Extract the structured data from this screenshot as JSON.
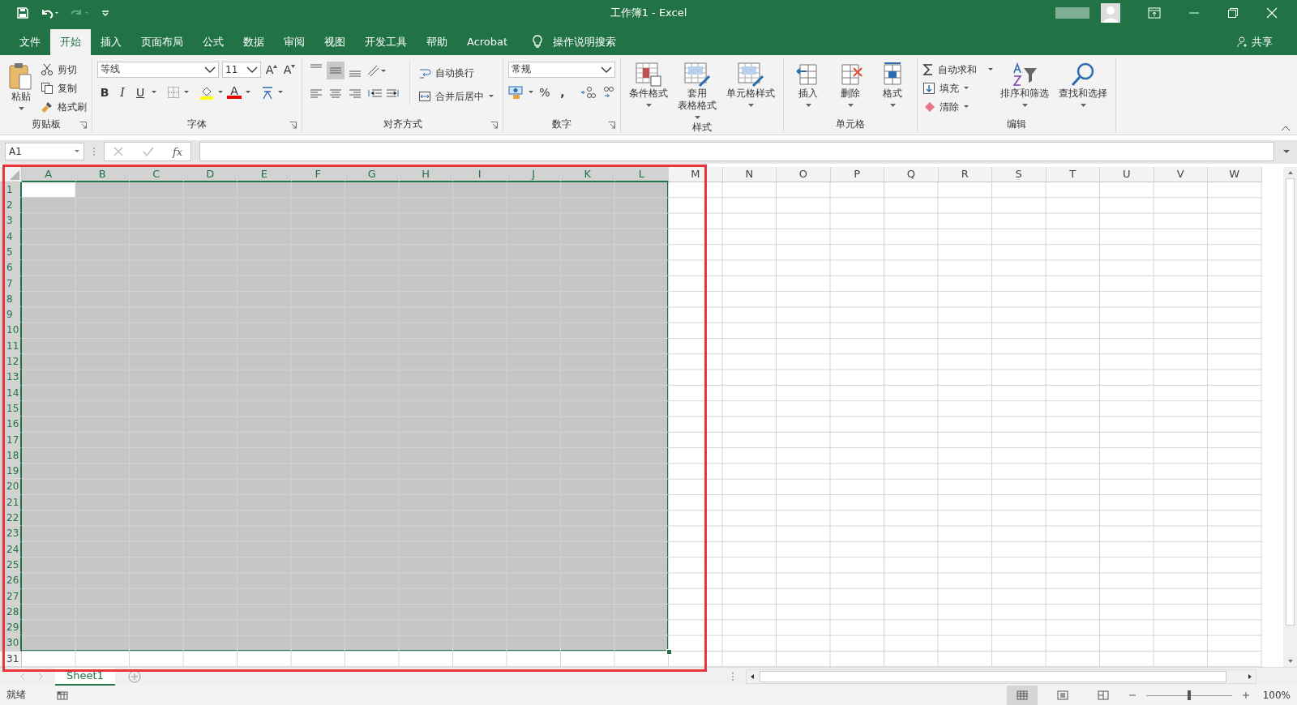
{
  "title_bar": {
    "title": "工作簿1  -  Excel",
    "share": "共享"
  },
  "tabs": [
    {
      "label": "文件",
      "selected": false
    },
    {
      "label": "开始",
      "selected": true
    },
    {
      "label": "插入",
      "selected": false
    },
    {
      "label": "页面布局",
      "selected": false
    },
    {
      "label": "公式",
      "selected": false
    },
    {
      "label": "数据",
      "selected": false
    },
    {
      "label": "审阅",
      "selected": false
    },
    {
      "label": "视图",
      "selected": false
    },
    {
      "label": "开发工具",
      "selected": false
    },
    {
      "label": "帮助",
      "selected": false
    },
    {
      "label": "Acrobat",
      "selected": false
    }
  ],
  "tell_me": "操作说明搜索",
  "ribbon": {
    "clipboard": {
      "label": "剪贴板",
      "paste": "粘贴",
      "cut": "剪切",
      "copy": "复制",
      "format_painter": "格式刷"
    },
    "font": {
      "label": "字体",
      "font_name": "等线",
      "font_size": "11",
      "grow": "A",
      "shrink": "A",
      "styles": [
        "B",
        "I",
        "U"
      ],
      "font_color": "A"
    },
    "alignment": {
      "label": "对齐方式",
      "wrap_text": "自动换行",
      "merge_center": "合并后居中"
    },
    "number": {
      "label": "数字",
      "format": "常规",
      "buttons": [
        "%",
        ","
      ]
    },
    "styles": {
      "label": "样式",
      "items": [
        {
          "lines": [
            "条件格式"
          ]
        },
        {
          "lines": [
            "套用",
            "表格格式"
          ]
        },
        {
          "lines": [
            "单元格样式"
          ]
        }
      ]
    },
    "cells": {
      "label": "单元格",
      "items": [
        "插入",
        "删除",
        "格式"
      ]
    },
    "editing": {
      "label": "编辑",
      "autosum": "自动求和",
      "fill": "填充",
      "clear": "清除",
      "sort_filter": "排序和筛选",
      "find_select": "查找和选择"
    }
  },
  "formula_bar": {
    "name_box": "A1",
    "fx": "fx"
  },
  "sheet": {
    "columns": [
      {
        "label": "A",
        "selected": true
      },
      {
        "label": "B",
        "selected": true
      },
      {
        "label": "C",
        "selected": true
      },
      {
        "label": "D",
        "selected": true
      },
      {
        "label": "E",
        "selected": true
      },
      {
        "label": "F",
        "selected": true
      },
      {
        "label": "G",
        "selected": true
      },
      {
        "label": "H",
        "selected": true
      },
      {
        "label": "I",
        "selected": true
      },
      {
        "label": "J",
        "selected": true
      },
      {
        "label": "K",
        "selected": true
      },
      {
        "label": "L",
        "selected": true
      },
      {
        "label": "M",
        "selected": false
      },
      {
        "label": "N",
        "selected": false
      },
      {
        "label": "O",
        "selected": false
      },
      {
        "label": "P",
        "selected": false
      },
      {
        "label": "Q",
        "selected": false
      },
      {
        "label": "R",
        "selected": false
      },
      {
        "label": "S",
        "selected": false
      },
      {
        "label": "T",
        "selected": false
      },
      {
        "label": "U",
        "selected": false
      },
      {
        "label": "V",
        "selected": false
      },
      {
        "label": "W",
        "selected": false
      }
    ],
    "rows": [
      {
        "label": "1",
        "selected": true
      },
      {
        "label": "2",
        "selected": true
      },
      {
        "label": "3",
        "selected": true
      },
      {
        "label": "4",
        "selected": true
      },
      {
        "label": "5",
        "selected": true
      },
      {
        "label": "6",
        "selected": true
      },
      {
        "label": "7",
        "selected": true
      },
      {
        "label": "8",
        "selected": true
      },
      {
        "label": "9",
        "selected": true
      },
      {
        "label": "10",
        "selected": true
      },
      {
        "label": "11",
        "selected": true
      },
      {
        "label": "12",
        "selected": true
      },
      {
        "label": "13",
        "selected": true
      },
      {
        "label": "14",
        "selected": true
      },
      {
        "label": "15",
        "selected": true
      },
      {
        "label": "16",
        "selected": true
      },
      {
        "label": "17",
        "selected": true
      },
      {
        "label": "18",
        "selected": true
      },
      {
        "label": "19",
        "selected": true
      },
      {
        "label": "20",
        "selected": true
      },
      {
        "label": "21",
        "selected": true
      },
      {
        "label": "22",
        "selected": true
      },
      {
        "label": "23",
        "selected": true
      },
      {
        "label": "24",
        "selected": true
      },
      {
        "label": "25",
        "selected": true
      },
      {
        "label": "26",
        "selected": true
      },
      {
        "label": "27",
        "selected": true
      },
      {
        "label": "28",
        "selected": true
      },
      {
        "label": "29",
        "selected": true
      },
      {
        "label": "30",
        "selected": true
      },
      {
        "label": "31",
        "selected": false
      }
    ]
  },
  "sheet_tabs": [
    {
      "label": "Sheet1",
      "selected": true
    }
  ],
  "status_bar": {
    "status": "就绪",
    "views": [
      {
        "selected": true
      },
      {
        "selected": false
      },
      {
        "selected": false
      }
    ],
    "zoom_slider": {
      "level": 0.5
    },
    "zoom": "100%"
  }
}
